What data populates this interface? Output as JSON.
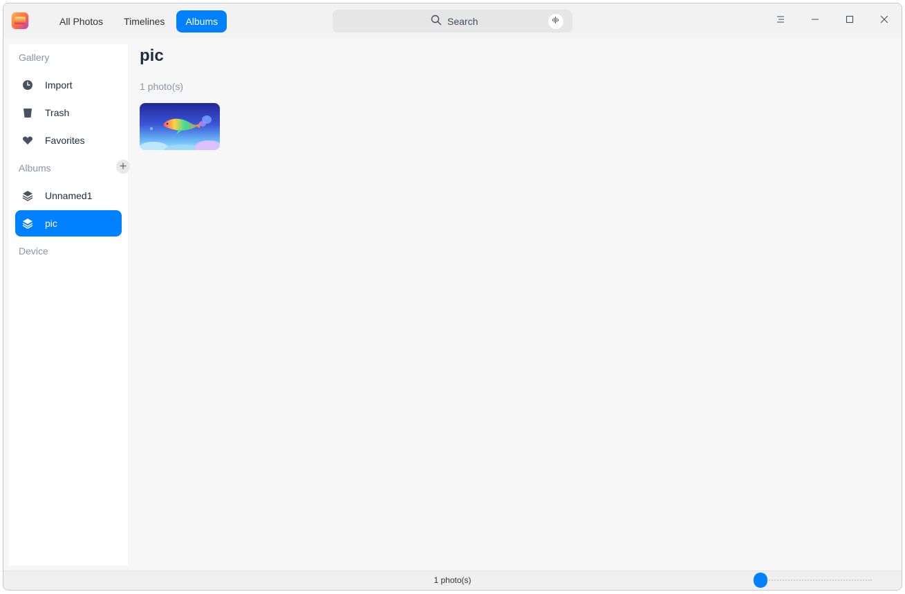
{
  "titlebar": {
    "tabs": [
      {
        "label": "All Photos",
        "active": false
      },
      {
        "label": "Timelines",
        "active": false
      },
      {
        "label": "Albums",
        "active": true
      }
    ],
    "search": {
      "placeholder": "Search"
    }
  },
  "sidebar": {
    "gallery_title": "Gallery",
    "gallery_items": [
      {
        "label": "Import",
        "icon": "clock-icon"
      },
      {
        "label": "Trash",
        "icon": "trash-icon"
      },
      {
        "label": "Favorites",
        "icon": "heart-icon"
      }
    ],
    "albums_title": "Albums",
    "album_items": [
      {
        "label": "Unnamed1",
        "icon": "album-stack-icon",
        "active": false
      },
      {
        "label": "pic",
        "icon": "album-stack-icon",
        "active": true
      }
    ],
    "device_title": "Device"
  },
  "main": {
    "album_title": "pic",
    "photo_count": "1 photo(s)"
  },
  "statusbar": {
    "text": "1 photo(s)",
    "zoom_level": 0
  },
  "colors": {
    "accent": "#0081ff",
    "window_bg": "#f7f7f8",
    "sidebar_bg": "#ffffff",
    "muted_text": "#8a96a8"
  }
}
